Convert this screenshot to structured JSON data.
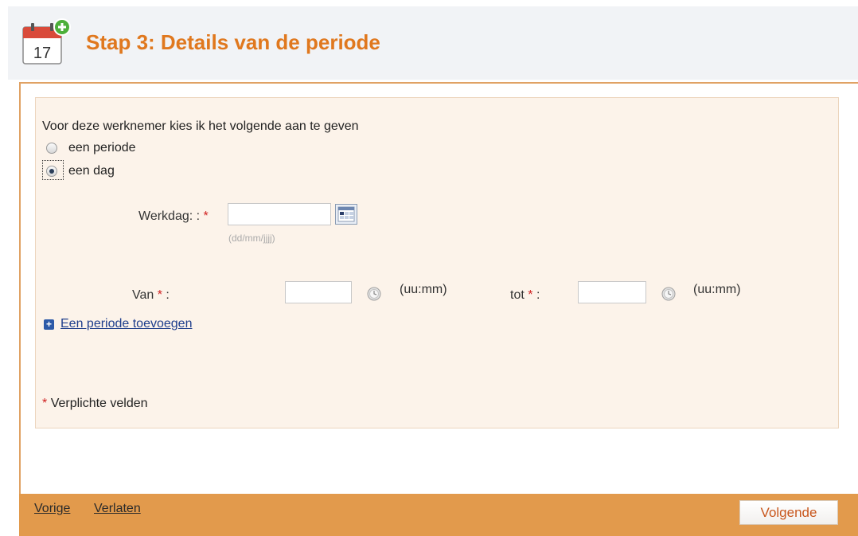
{
  "header": {
    "title": "Stap 3: Details van de periode",
    "calendar_day": "17",
    "icon": "calendar-add-icon"
  },
  "form": {
    "intro": "Voor deze werknemer kies ik het volgende aan te geven",
    "options": [
      {
        "label": "een periode",
        "checked": false
      },
      {
        "label": "een dag",
        "checked": true
      }
    ],
    "workday": {
      "label": "Werkdag: :",
      "required_mark": "*",
      "value": "",
      "hint": "(dd/mm/jjjj)",
      "picker_icon": "calendar-picker-icon"
    },
    "from": {
      "label": "Van",
      "required_mark": "*",
      "colon": ":",
      "value": "",
      "unit": "(uu:mm)",
      "icon": "clock-icon"
    },
    "to": {
      "label": "tot",
      "required_mark": "*",
      "colon": ":",
      "value": "",
      "unit": "(uu:mm)",
      "icon": "clock-icon"
    },
    "add_period_link": "Een periode toevoegen",
    "required_note_mark": "*",
    "required_note": "Verplichte velden"
  },
  "footer": {
    "prev": "Vorige",
    "leave": "Verlaten",
    "next": "Volgende"
  },
  "colors": {
    "accent": "#e0781e",
    "footer": "#e29a4c",
    "panel": "#fcf3ea",
    "required": "#d02020",
    "link": "#1f3e8c"
  }
}
